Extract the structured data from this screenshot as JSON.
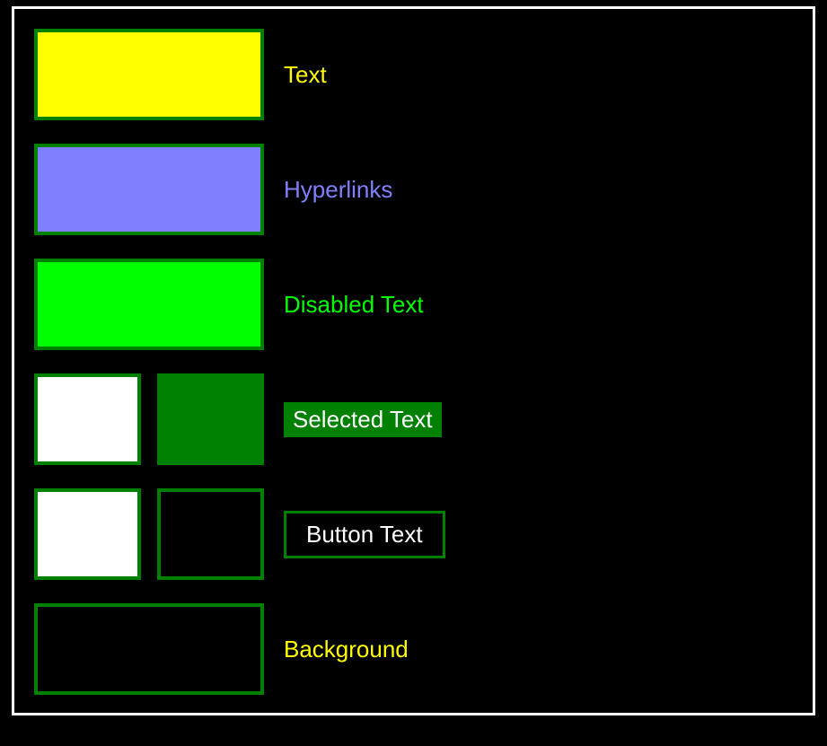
{
  "rows": {
    "text": {
      "label": "Text",
      "colors": [
        "#ffff00"
      ]
    },
    "hyperlinks": {
      "label": "Hyperlinks",
      "colors": [
        "#8080ff"
      ]
    },
    "disabled": {
      "label": "Disabled Text",
      "colors": [
        "#00ff00"
      ]
    },
    "selected": {
      "label": "Selected Text",
      "colors": [
        "#ffffff",
        "#008000"
      ]
    },
    "button": {
      "label": "Button Text",
      "colors": [
        "#ffffff",
        "#000000"
      ]
    },
    "background": {
      "label": "Background",
      "colors": [
        "#000000"
      ]
    }
  },
  "border_color": "#008000",
  "panel_border": "#ffffff"
}
